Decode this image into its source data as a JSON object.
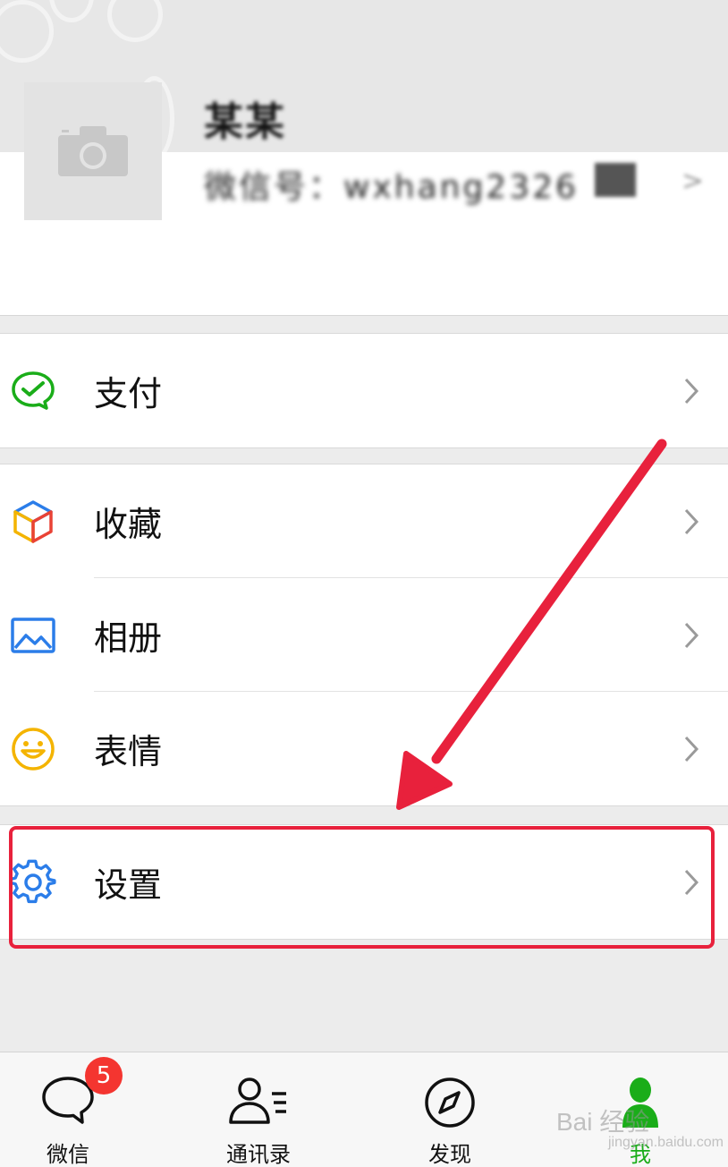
{
  "profile": {
    "nickname": "某某",
    "wechat_id": "微信号：wxhang2326"
  },
  "menu": {
    "pay": {
      "label": "支付",
      "icon": "wechat-pay-icon",
      "color": "#1aad19"
    },
    "favorites": {
      "label": "收藏",
      "icon": "cube-icon",
      "color": "#2b7de9"
    },
    "album": {
      "label": "相册",
      "icon": "picture-icon",
      "color": "#2b7de9"
    },
    "stickers": {
      "label": "表情",
      "icon": "smiley-icon",
      "color": "#f4b400"
    },
    "settings": {
      "label": "设置",
      "icon": "gear-icon",
      "color": "#2b7de9"
    }
  },
  "tabbar": {
    "chats": {
      "label": "微信",
      "badge": "5"
    },
    "contacts": {
      "label": "通讯录"
    },
    "discover": {
      "label": "发现"
    },
    "me": {
      "label": "我",
      "active": true
    }
  },
  "colors": {
    "active_tab": "#1aad19",
    "badge": "#f43530",
    "annotation": "#e8213c"
  },
  "watermark": {
    "text": "Bai 经验",
    "sub": "jingyan.baidu.com"
  }
}
